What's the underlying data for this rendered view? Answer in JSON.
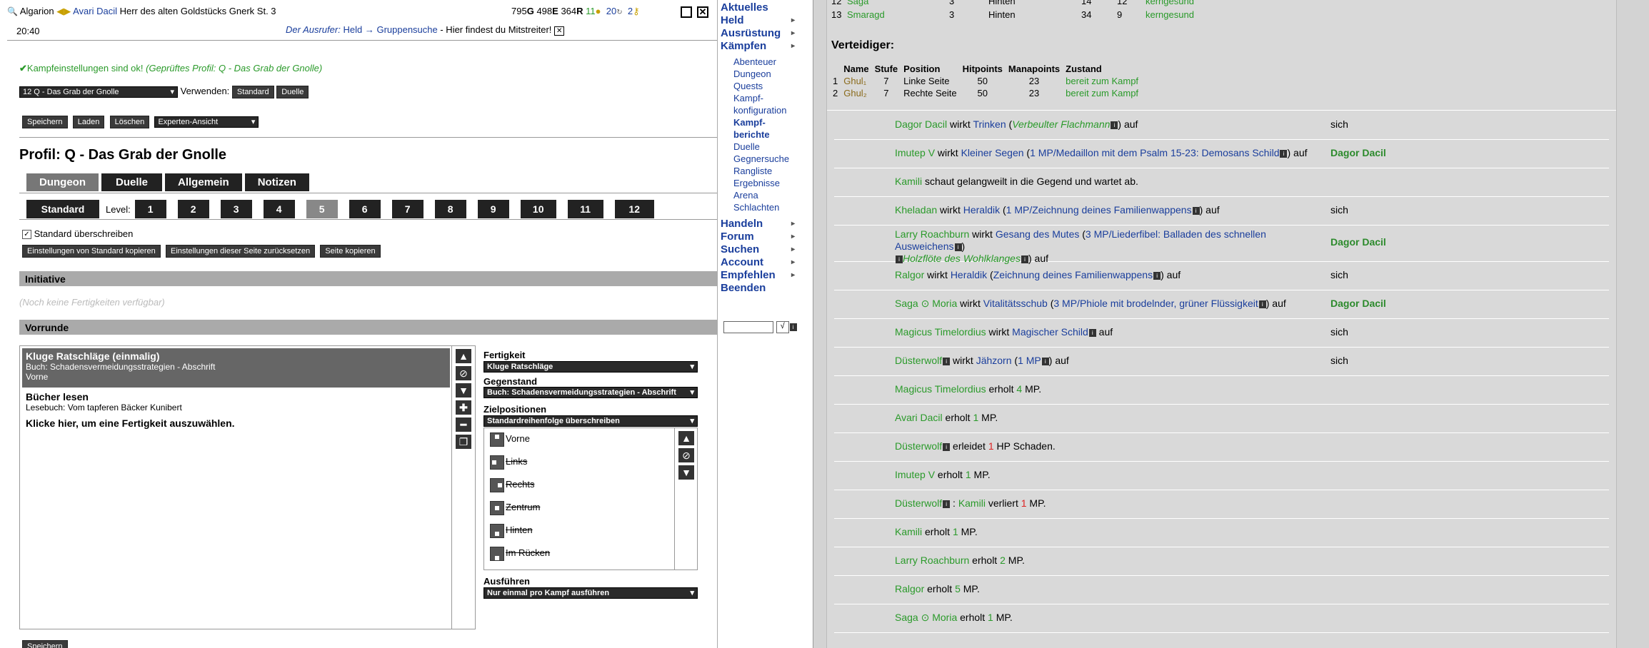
{
  "topbar": {
    "player": "Algarion",
    "char_name": "Avari Dacil",
    "char_title": "Herr des alten Goldstücks Gnerk St. 3",
    "stat_g": "795",
    "stat_g_unit": "G",
    "stat_e": "498",
    "stat_e_unit": "E",
    "stat_r": "364",
    "stat_r_unit": "R",
    "stat_x": "11",
    "stat_y": "20",
    "stat_z": "2",
    "time": "20:40",
    "news_prefix": "Der Ausrufer:",
    "news_link1": "Held",
    "news_arrow": "→",
    "news_link2": "Gruppensuche",
    "news_suffix": "- Hier findest du Mitstreiter!"
  },
  "left": {
    "ok_msg": "Kampfeinstellungen sind ok!",
    "ok_profile": "(Geprüftes Profil: Q - Das Grab der Gnolle)",
    "profile_select": "12 Q - Das Grab der Gnolle",
    "use_label": "Verwenden:",
    "use_standard": "Standard",
    "use_duelle": "Duelle",
    "btn_save": "Speichern",
    "btn_load": "Laden",
    "btn_delete": "Löschen",
    "view_select": "Experten-Ansicht",
    "profile_title": "Profil: Q - Das Grab der Gnolle",
    "tabs": [
      {
        "label": "Dungeon"
      },
      {
        "label": "Duelle"
      },
      {
        "label": "Allgemein"
      },
      {
        "label": "Notizen"
      }
    ],
    "std_btn": "Standard",
    "level_label": "Level:",
    "levels": [
      "1",
      "2",
      "3",
      "4",
      "5",
      "6",
      "7",
      "8",
      "9",
      "10",
      "11",
      "12"
    ],
    "override_label": "Standard überschreiben",
    "copy_std": "Einstellungen von Standard kopieren",
    "reset_page": "Einstellungen dieser Seite zurücksetzen",
    "copy_page": "Seite kopieren",
    "initiative_head": "Initiative",
    "initiative_empty": "(Noch keine Fertigkeiten verfügbar)",
    "vorrunde_head": "Vorrunde",
    "skills": [
      {
        "name": "Kluge Ratschläge (einmalig)",
        "line2": "Buch: Schadensvermeidungsstrategien - Abschrift",
        "line3": "Vorne"
      },
      {
        "name": "Bücher lesen",
        "line2": "Lesebuch: Vom tapferen Bäcker Kunibert",
        "line3": ""
      }
    ],
    "click_hint": "Klicke hier, um eine Fertigkeit auszuwählen.",
    "fertigkeit_label": "Fertigkeit",
    "fertigkeit_value": "Kluge Ratschläge",
    "gegenstand_label": "Gegenstand",
    "gegenstand_value": "Buch: Schadensvermeidungsstrategien - Abschrift",
    "ziel_label": "Zielpositionen",
    "ziel_value": "Standardreihenfolge überschreiben",
    "positions": [
      "Vorne",
      "Links",
      "Rechts",
      "Zentrum",
      "Hinten",
      "Im Rücken"
    ],
    "ausfuehren_label": "Ausführen",
    "ausfuehren_value": "Nur einmal pro Kampf ausführen",
    "bottom_save": "Speichern"
  },
  "menu": {
    "main1": [
      "Aktuelles",
      "Held",
      "Ausrüstung",
      "Kämpfen"
    ],
    "sub": [
      "Abenteuer",
      "Dungeon",
      "Quests",
      "Kampf-\nkonfiguration",
      "Kampf-\nberichte",
      "Duelle",
      "Gegnersuche",
      "Rangliste",
      "Ergebnisse",
      "Arena",
      "Schlachten"
    ],
    "main2": [
      "Handeln",
      "Forum",
      "Suchen",
      "Account",
      "Empfehlen",
      "Beenden"
    ],
    "search_btn": "√"
  },
  "report": {
    "top_rows": [
      {
        "num": "12",
        "name": "Saga",
        "stufe": "3",
        "pos": "Hinten",
        "hp": "14",
        "mp": "12",
        "state": "kerngesund"
      },
      {
        "num": "13",
        "name": "Smaragd",
        "stufe": "3",
        "pos": "Hinten",
        "hp": "34",
        "mp": "9",
        "state": "kerngesund"
      }
    ],
    "def_title": "Verteidiger:",
    "def_headers": [
      "Name",
      "Stufe",
      "Position",
      "Hitpoints",
      "Manapoints",
      "Zustand"
    ],
    "defenders": [
      {
        "num": "1",
        "name": "Ghul₁",
        "stufe": "7",
        "pos": "Linke Seite",
        "hp": "50",
        "mp": "23",
        "state": "bereit zum Kampf"
      },
      {
        "num": "2",
        "name": "Ghul₂",
        "stufe": "7",
        "pos": "Rechte Seite",
        "hp": "50",
        "mp": "23",
        "state": "bereit zum Kampf"
      }
    ],
    "log": [
      {
        "actor": "Dagor Dacil",
        "verb": " wirkt ",
        "skill": "Trinken",
        "detail": "Verbeulter Flachmann",
        "tail": " auf",
        "target": "sich"
      },
      {
        "actor": "Imutep V",
        "verb": " wirkt ",
        "skill": "Kleiner Segen",
        "detail": "1 MP/Medaillon mit dem Psalm 15-23: Demosans Schild",
        "tail": " auf",
        "target": "Dagor Dacil"
      },
      {
        "actor": "Kamili",
        "verb": " schaut gelangweilt in die Gegend und wartet ab.",
        "skill": "",
        "detail": "",
        "tail": "",
        "target": ""
      },
      {
        "actor": "Kheladan",
        "verb": " wirkt ",
        "skill": "Heraldik",
        "detail": "1 MP/Zeichnung deines Familienwappens",
        "tail": " auf",
        "target": "sich"
      },
      {
        "actor": "Larry Roachburn",
        "verb": " wirkt ",
        "skill": "Gesang des Mutes",
        "detail": "3 MP/Liederfibel: Balladen des schnellen Ausweichens",
        "detail2": "Holzflöte des Wohlklanges",
        "tail": " auf",
        "target": "Dagor Dacil"
      },
      {
        "actor": "Ralgor",
        "verb": " wirkt ",
        "skill": "Heraldik",
        "detail": "Zeichnung deines Familienwappens",
        "tail": " auf",
        "target": "sich"
      },
      {
        "actor": "Saga",
        "actor2": "Moria",
        "verb": " wirkt ",
        "skill": "Vitalitätsschub",
        "detail": "3 MP/Phiole mit brodelnder, grüner Flüssigkeit",
        "tail": " auf",
        "target": "Dagor Dacil"
      },
      {
        "actor": "Magicus Timelordius",
        "verb": " wirkt ",
        "skill": "Magischer Schild",
        "detail": "",
        "tail": " auf",
        "target": "sich"
      },
      {
        "actor": "Düsterwolf",
        "verb": " wirkt ",
        "skill": "Jähzorn",
        "detail": "1 MP",
        "tail": " auf",
        "target": "sich"
      },
      {
        "actor": "Magicus Timelordius",
        "verb": " erholt ",
        "num": "4",
        "rest": " MP.",
        "target": ""
      },
      {
        "actor": "Avari Dacil",
        "verb": " erholt ",
        "num": "1",
        "rest": " MP.",
        "target": ""
      },
      {
        "actor": "Düsterwolf",
        "verb": " erleidet ",
        "num": "1",
        "rest": " HP Schaden.",
        "target": ""
      },
      {
        "actor": "Imutep V",
        "verb": " erholt ",
        "num": "1",
        "rest": " MP.",
        "target": ""
      },
      {
        "actor": "Düsterwolf",
        "verb": " : ",
        "actor2": "Kamili",
        "verb2": " verliert ",
        "num": "1",
        "rest": " MP.",
        "target": ""
      },
      {
        "actor": "Kamili",
        "verb": " erholt ",
        "num": "1",
        "rest": " MP.",
        "target": ""
      },
      {
        "actor": "Larry Roachburn",
        "verb": " erholt ",
        "num": "2",
        "rest": " MP.",
        "target": ""
      },
      {
        "actor": "Ralgor",
        "verb": " erholt ",
        "num": "5",
        "rest": " MP.",
        "target": ""
      },
      {
        "actor": "Saga",
        "actor2": "Moria",
        "verb": " erholt ",
        "num": "1",
        "rest": " MP.",
        "target": ""
      }
    ]
  }
}
